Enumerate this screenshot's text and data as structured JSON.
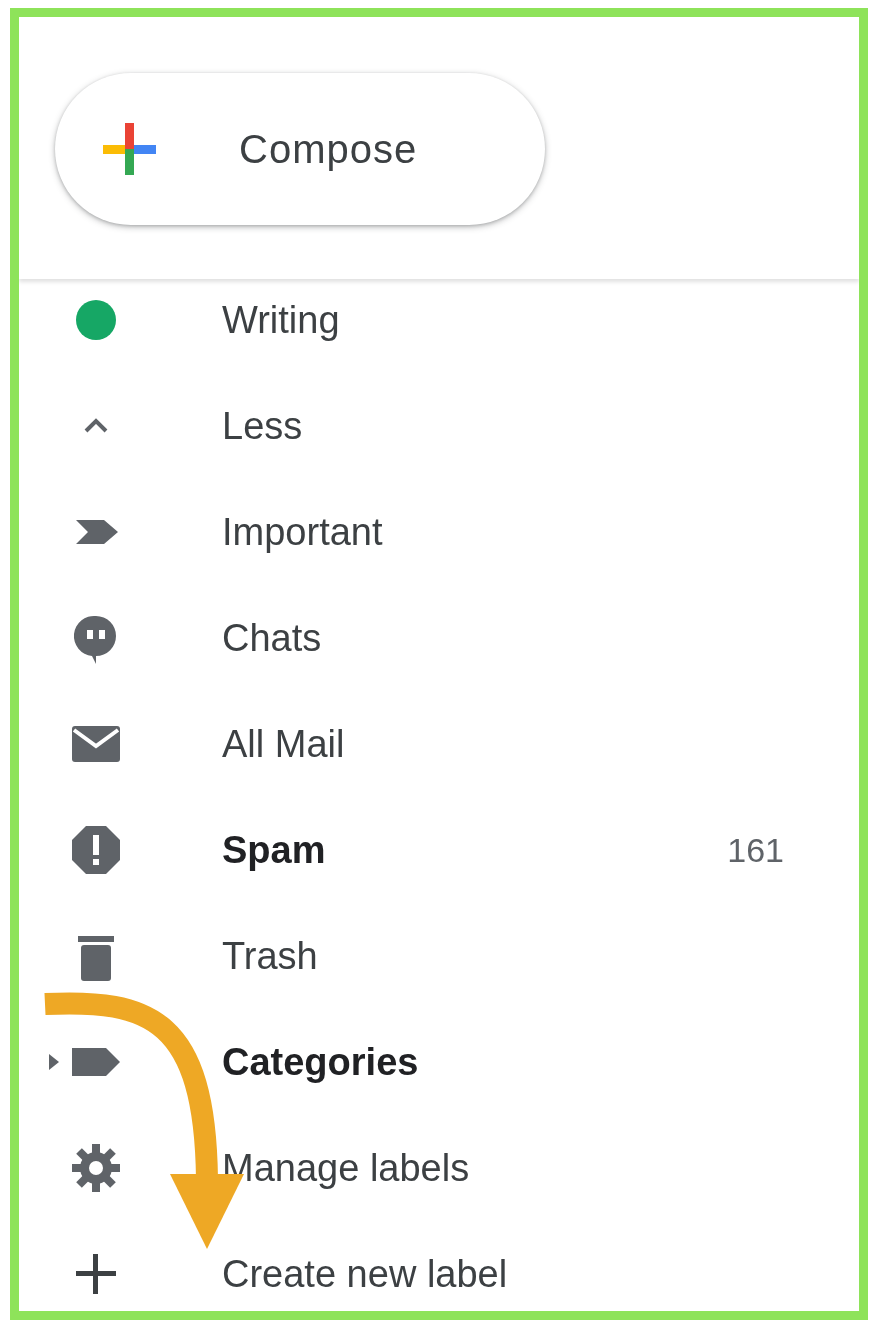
{
  "compose": {
    "label": "Compose"
  },
  "items": [
    {
      "kind": "writing",
      "label": "Writing",
      "bold": false
    },
    {
      "kind": "less",
      "label": "Less",
      "bold": false
    },
    {
      "kind": "important",
      "label": "Important",
      "bold": false
    },
    {
      "kind": "chats",
      "label": "Chats",
      "bold": false
    },
    {
      "kind": "allmail",
      "label": "All Mail",
      "bold": false
    },
    {
      "kind": "spam",
      "label": "Spam",
      "bold": true,
      "count": "161"
    },
    {
      "kind": "trash",
      "label": "Trash",
      "bold": false
    },
    {
      "kind": "categories",
      "label": "Categories",
      "bold": true,
      "expanded": false
    },
    {
      "kind": "manage",
      "label": "Manage labels",
      "bold": false
    },
    {
      "kind": "create",
      "label": "Create new label",
      "bold": false
    }
  ]
}
